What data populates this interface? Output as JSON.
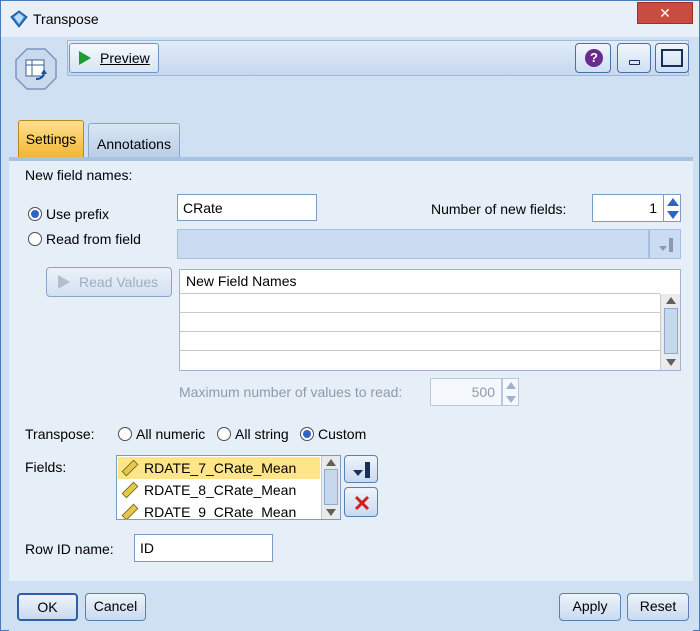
{
  "window": {
    "title": "Transpose",
    "close_glyph": "✕"
  },
  "toolbar": {
    "preview_label": "Preview",
    "help_glyph": "?"
  },
  "tabs": [
    {
      "label": "Settings",
      "active": true
    },
    {
      "label": "Annotations",
      "active": false
    }
  ],
  "settings": {
    "new_field_names_label": "New field names:",
    "use_prefix_label": "Use prefix",
    "read_from_field_label": "Read from field",
    "prefix_value": "CRate",
    "number_of_new_fields_label": "Number of new fields:",
    "number_of_new_fields_value": "1",
    "read_values_label": "Read Values",
    "grid_header": "New Field Names",
    "max_values_label": "Maximum number of values to read:",
    "max_values_value": "500",
    "transpose_label": "Transpose:",
    "transpose_options": [
      "All numeric",
      "All string",
      "Custom"
    ],
    "transpose_selected": "Custom",
    "fields_label": "Fields:",
    "fields": [
      "RDATE_7_CRate_Mean",
      "RDATE_8_CRate_Mean",
      "RDATE_9_CRate_Mean"
    ],
    "row_id_label": "Row ID name:",
    "row_id_value": "ID"
  },
  "buttons": {
    "ok": "OK",
    "cancel": "Cancel",
    "apply": "Apply",
    "reset": "Reset"
  },
  "colors": {
    "active_tab": "#f2b532",
    "delete_red": "#d02020",
    "selected_field": "#ffe58a"
  }
}
